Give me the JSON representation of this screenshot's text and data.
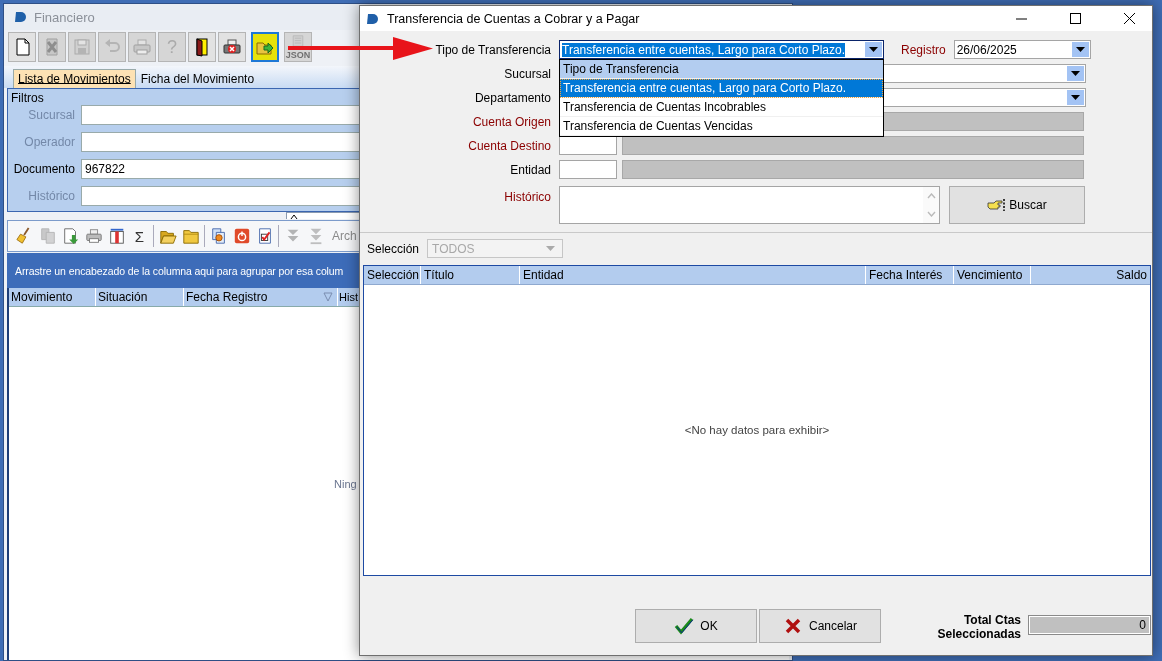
{
  "main_window": {
    "title": "Financiero",
    "toolbar": [
      {
        "kind": "new",
        "disabled": false,
        "selected": false
      },
      {
        "kind": "delete",
        "disabled": true,
        "selected": false
      },
      {
        "kind": "save",
        "disabled": true,
        "selected": false
      },
      {
        "kind": "undo",
        "disabled": true,
        "selected": false
      },
      {
        "kind": "print",
        "disabled": true,
        "selected": false
      },
      {
        "kind": "help",
        "text": "?",
        "disabled": true,
        "selected": false
      },
      {
        "kind": "exit",
        "disabled": false,
        "selected": false
      },
      {
        "kind": "cancel-print",
        "disabled": false,
        "selected": false
      },
      {
        "kind": "export",
        "disabled": false,
        "selected": true
      },
      {
        "kind": "json",
        "text": "JSON",
        "disabled": true,
        "selected": false
      }
    ],
    "tabs": [
      {
        "label": "Lista de Movimientos",
        "selected": true
      },
      {
        "label": "Ficha del Movimiento",
        "selected": false
      }
    ],
    "filters": {
      "title": "Filtros",
      "fields": [
        {
          "label": "Sucursal",
          "disabled": true
        },
        {
          "label": "Operador",
          "disabled": true
        },
        {
          "label": "Documento",
          "value": "967822",
          "disabled": false
        },
        {
          "label": "Histórico",
          "disabled": true
        }
      ]
    },
    "grid_toolbar": [
      {
        "kind": "broom",
        "disabled": false
      },
      {
        "kind": "copy",
        "disabled": true
      },
      {
        "kind": "import",
        "disabled": false
      },
      {
        "kind": "print",
        "disabled": false
      },
      {
        "kind": "columns",
        "disabled": false
      },
      {
        "kind": "sum",
        "text": "Σ",
        "disabled": false
      },
      {
        "kind": "separator"
      },
      {
        "kind": "folder-open",
        "disabled": false
      },
      {
        "kind": "folder",
        "disabled": false
      },
      {
        "kind": "separator"
      },
      {
        "kind": "export",
        "disabled": false
      },
      {
        "kind": "stop",
        "disabled": false
      },
      {
        "kind": "checklist",
        "disabled": false
      },
      {
        "kind": "separator"
      },
      {
        "kind": "move-down",
        "disabled": true
      },
      {
        "kind": "move-bottom",
        "disabled": true
      },
      {
        "kind": "label",
        "text": "Arch",
        "disabled": true
      }
    ],
    "group_hint": "Arrastre un encabezado de la columna aqui para agrupar por esa colum",
    "columns": [
      {
        "label": "Movimiento",
        "filter": false
      },
      {
        "label": "Situación",
        "filter": false
      },
      {
        "label": "Fecha Registro",
        "filter": true
      },
      {
        "label": "Hist"
      }
    ],
    "empty_message": "Ning"
  },
  "dialog": {
    "title": "Transferencia de Cuentas a Cobrar y a Pagar",
    "tipo": {
      "label": "Tipo de Transferencia",
      "required": false,
      "value": "Transferencia entre cuentas, Largo para Corto Plazo.",
      "expanded": true,
      "options": [
        {
          "label": "Tipo de Transferencia",
          "selected": false,
          "hovered": true
        },
        {
          "label": "Transferencia entre cuentas, Largo para Corto Plazo.",
          "selected": true,
          "hovered": false
        },
        {
          "label": "Transferencia de Cuentas Incobrables",
          "selected": false,
          "hovered": false
        },
        {
          "label": "Transferencia de Cuentas Vencidas",
          "selected": false,
          "hovered": false
        }
      ]
    },
    "registro": {
      "label": "Registro",
      "required": true,
      "value": "26/06/2025"
    },
    "fields": [
      {
        "kind": "combo",
        "label": "Sucursal",
        "required": false
      },
      {
        "kind": "combo",
        "label": "Departamento",
        "required": false
      },
      {
        "kind": "lookup",
        "label": "Cuenta Origen",
        "required": true
      },
      {
        "kind": "lookup",
        "label": "Cuenta Destino",
        "required": true
      },
      {
        "kind": "lookup",
        "label": "Entidad",
        "required": false
      }
    ],
    "historico": {
      "label": "Histórico",
      "required": true
    },
    "search_button": "Buscar",
    "seleccion": {
      "label": "Selección",
      "value": "TODOS",
      "disabled": true
    },
    "grid": {
      "columns": [
        {
          "label": "Selección"
        },
        {
          "label": "Título"
        },
        {
          "label": "Entidad"
        },
        {
          "label": "Fecha Interés"
        },
        {
          "label": "Vencimiento"
        },
        {
          "label": "Saldo"
        }
      ],
      "empty_message": "<No hay datos para exhibir>"
    },
    "buttons": [
      {
        "kind": "ok",
        "label": "OK"
      },
      {
        "kind": "cancel",
        "label": "Cancelar"
      }
    ],
    "total": {
      "label": "Total Ctas Seleccionadas",
      "value": "0"
    }
  }
}
